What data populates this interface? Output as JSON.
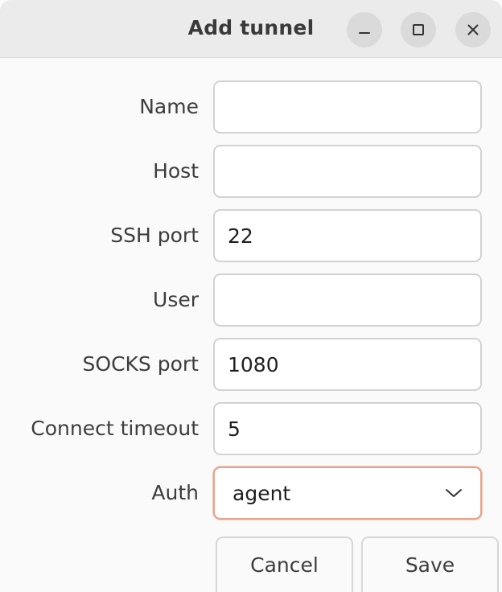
{
  "window": {
    "title": "Add tunnel",
    "controls": {
      "minimize": "minimize-icon",
      "maximize": "maximize-icon",
      "close": "close-icon"
    }
  },
  "form": {
    "name": {
      "label": "Name",
      "value": ""
    },
    "host": {
      "label": "Host",
      "value": ""
    },
    "ssh_port": {
      "label": "SSH port",
      "value": "22"
    },
    "user": {
      "label": "User",
      "value": ""
    },
    "socks_port": {
      "label": "SOCKS port",
      "value": "1080"
    },
    "connect_timeout": {
      "label": "Connect timeout",
      "value": "5"
    },
    "auth": {
      "label": "Auth",
      "selected": "agent",
      "icon": "chevron-down-icon"
    }
  },
  "actions": {
    "cancel_label": "Cancel",
    "save_label": "Save"
  },
  "colors": {
    "accent_focus_border": "#e3a58c",
    "titlebar": "#ebebeb",
    "background": "#fafafa"
  }
}
